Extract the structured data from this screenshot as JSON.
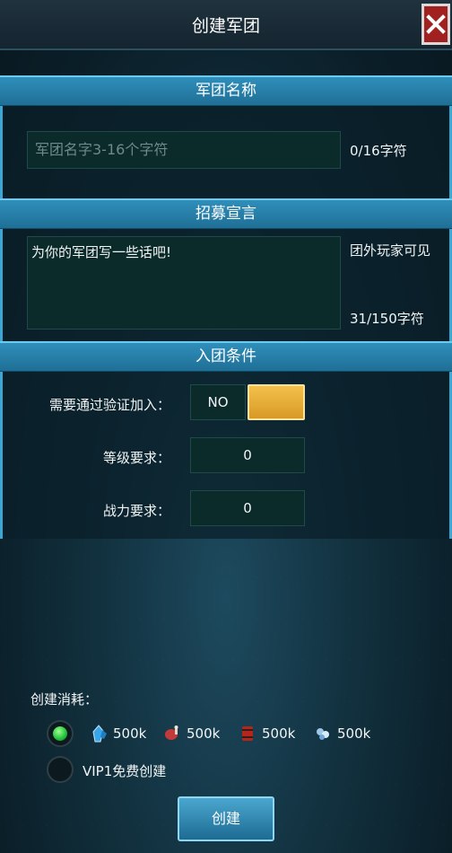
{
  "header": {
    "title": "创建军团"
  },
  "name_section": {
    "title": "军团名称",
    "placeholder": "军团名字3-16个字符",
    "count": "0/16字符"
  },
  "declaration_section": {
    "title": "招募宣言",
    "text": "为你的军团写一些话吧!",
    "visibility": "团外玩家可见",
    "count": "31/150字符"
  },
  "conditions_section": {
    "title": "入团条件",
    "verify_label": "需要通过验证加入：",
    "verify_value": "NO",
    "level_label": "等级要求：",
    "level_value": "0",
    "power_label": "战力要求：",
    "power_value": "0"
  },
  "cost": {
    "label": "创建消耗：",
    "resources": [
      {
        "icon": "crystal-icon",
        "amount": "500k"
      },
      {
        "icon": "meat-icon",
        "amount": "500k"
      },
      {
        "icon": "barrel-icon",
        "amount": "500k"
      },
      {
        "icon": "gem-icon",
        "amount": "500k"
      }
    ],
    "vip_option": "VIP1免费创建"
  },
  "create_button": "创建"
}
